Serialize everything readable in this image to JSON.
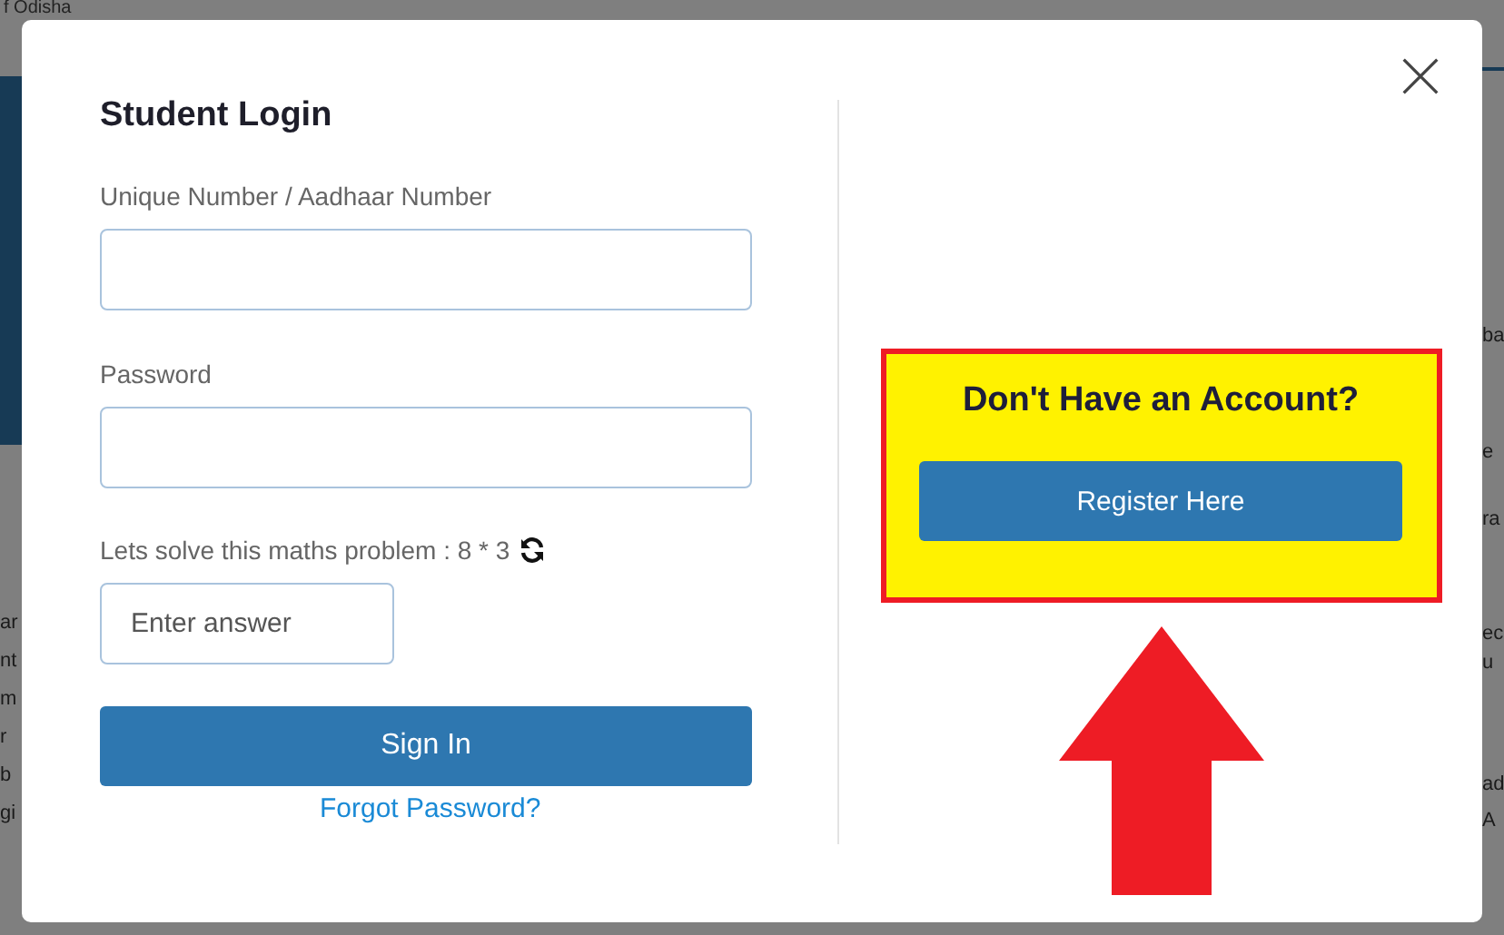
{
  "background": {
    "top_text": "f Odisha",
    "left_lines": [
      "ar",
      "nt",
      "m",
      "r",
      "b",
      "gi"
    ],
    "right_lines": [
      "ba",
      "e",
      "ra",
      "ec",
      "u",
      "ad",
      "A"
    ]
  },
  "modal": {
    "title": "Student Login",
    "fields": [
      {
        "label": "Unique Number / Aadhaar Number"
      },
      {
        "label": "Password"
      }
    ],
    "captcha": {
      "question": "Lets solve this maths problem : 8 * 3",
      "placeholder": "Enter answer"
    },
    "submit": "Sign In",
    "forgot": "Forgot Password?",
    "register": {
      "heading": "Don't Have an Account?",
      "button": "Register Here"
    }
  }
}
